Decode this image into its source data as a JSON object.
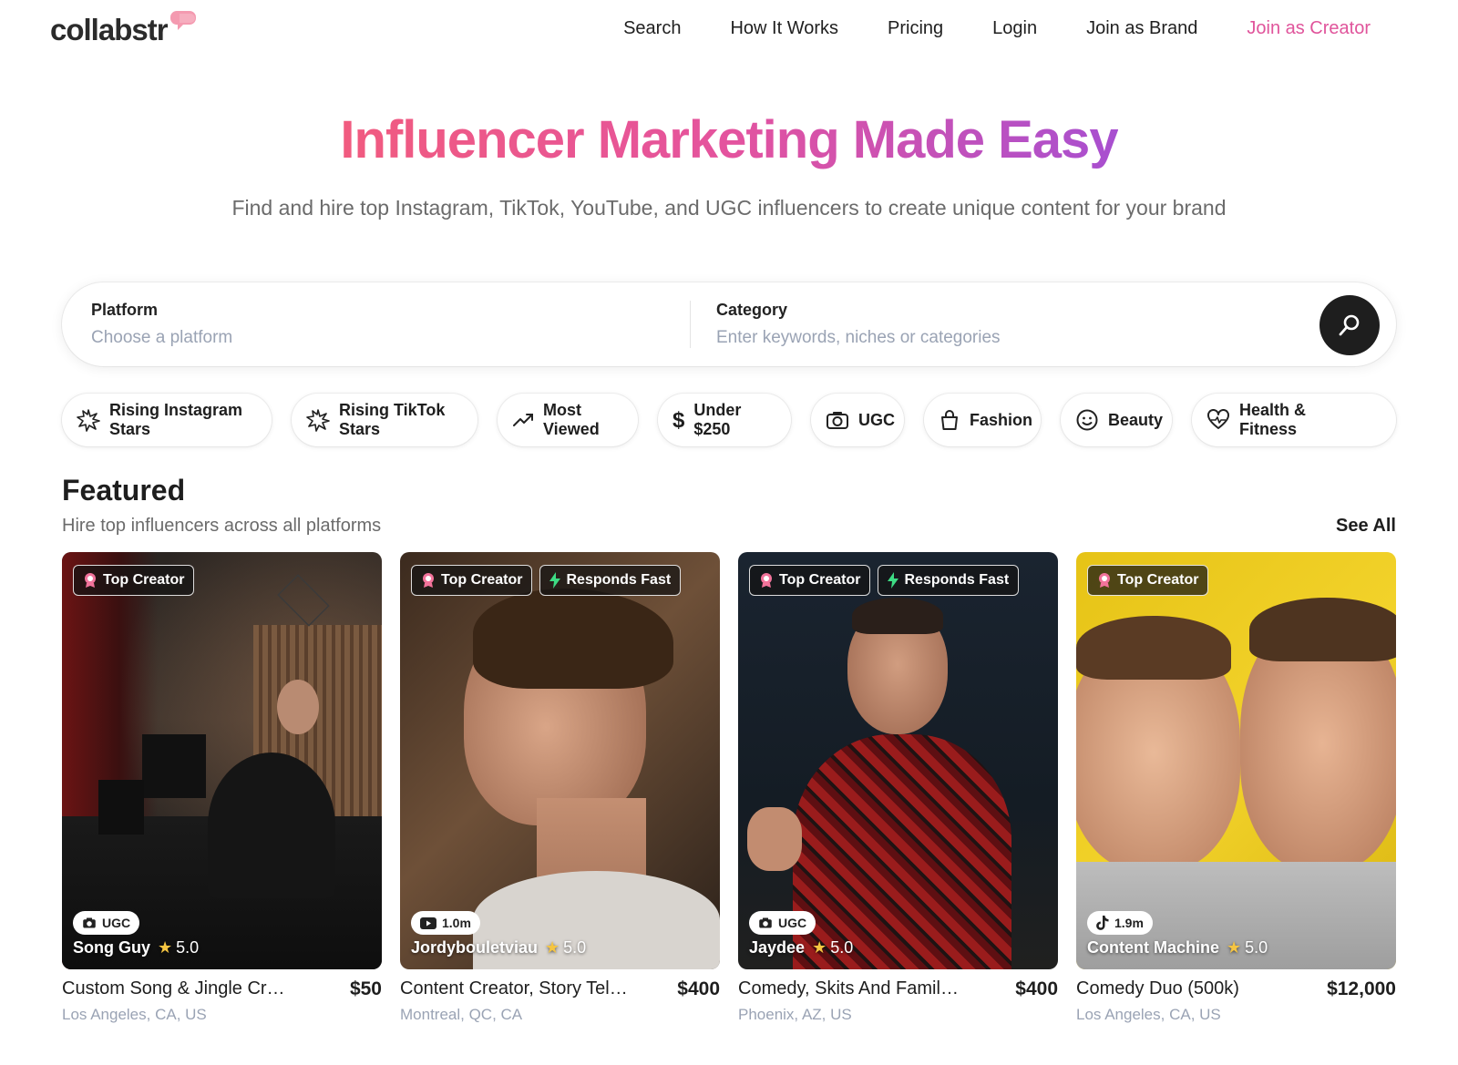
{
  "brand": {
    "logo_text": "collabstr",
    "accent": "#e0549b"
  },
  "nav": {
    "links": [
      "Search",
      "How It Works",
      "Pricing",
      "Login",
      "Join as Brand",
      "Join as Creator"
    ]
  },
  "hero": {
    "title": "Influencer Marketing Made Easy",
    "subtitle": "Find and hire top Instagram, TikTok, YouTube, and UGC influencers to create unique content for your brand"
  },
  "search": {
    "platform_label": "Platform",
    "platform_placeholder": "Choose a platform",
    "category_label": "Category",
    "category_placeholder": "Enter keywords, niches or categories",
    "button_icon": "search-icon"
  },
  "chips": [
    {
      "label": "Rising Instagram Stars",
      "icon": "sparkle-icon"
    },
    {
      "label": "Rising TikTok Stars",
      "icon": "sparkle-icon"
    },
    {
      "label": "Most Viewed",
      "icon": "trend-up-icon"
    },
    {
      "label": "Under $250",
      "icon": "dollar-icon"
    },
    {
      "label": "UGC",
      "icon": "camera-icon"
    },
    {
      "label": "Fashion",
      "icon": "bag-icon"
    },
    {
      "label": "Beauty",
      "icon": "face-icon"
    },
    {
      "label": "Health & Fitness",
      "icon": "heart-icon"
    }
  ],
  "featured": {
    "title": "Featured",
    "subtitle": "Hire top influencers across all platforms",
    "see_all": "See All",
    "cards": [
      {
        "badges": [
          "Top Creator"
        ],
        "platform": "UGC",
        "platform_icon": "camera-icon",
        "name": "Song Guy",
        "rating": "5.0",
        "title": "Custom Song & Jingle Creator",
        "price": "$50",
        "location": "Los Angeles, CA, US"
      },
      {
        "badges": [
          "Top Creator",
          "Responds Fast"
        ],
        "platform": "1.0m",
        "platform_icon": "youtube-icon",
        "name": "Jordybouletviau",
        "rating": "5.0",
        "title": "Content Creator, Story Teller...",
        "price": "$400",
        "location": "Montreal, QC, CA"
      },
      {
        "badges": [
          "Top Creator",
          "Responds Fast"
        ],
        "platform": "UGC",
        "platform_icon": "camera-icon",
        "name": "Jaydee",
        "rating": "5.0",
        "title": "Comedy, Skits And Family Cont...",
        "price": "$400",
        "location": "Phoenix, AZ, US"
      },
      {
        "badges": [
          "Top Creator"
        ],
        "platform": "1.9m",
        "platform_icon": "tiktok-icon",
        "name": "Content Machine",
        "rating": "5.0",
        "title": "Comedy Duo (500k)",
        "price": "$12,000",
        "location": "Los Angeles, CA, US"
      }
    ]
  }
}
